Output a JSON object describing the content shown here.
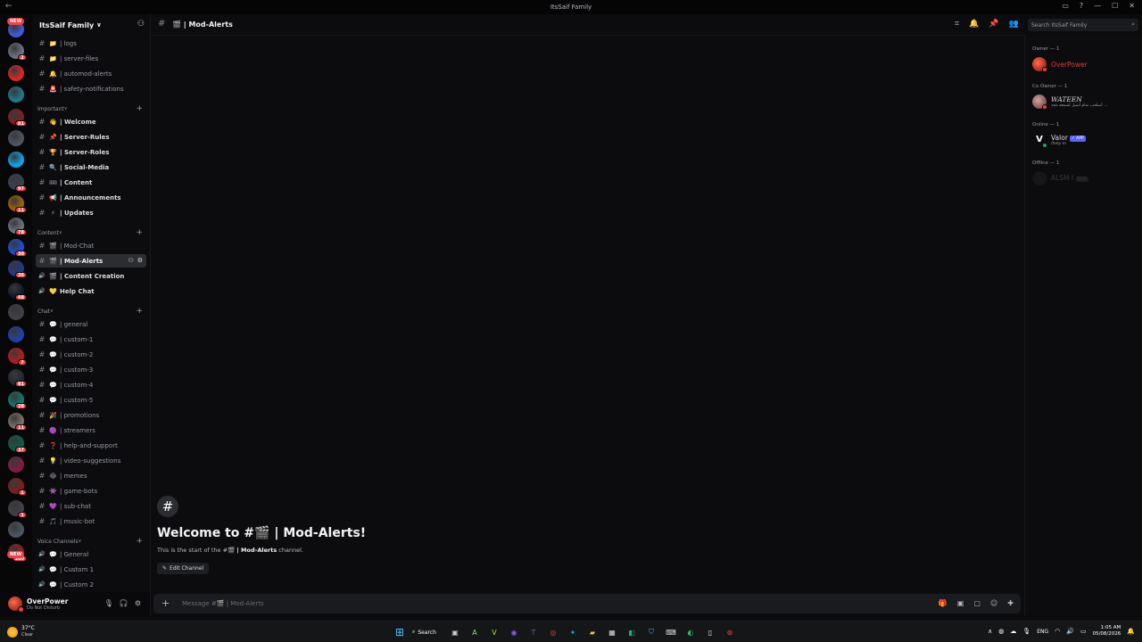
{
  "window": {
    "title": "ItsSaif Family"
  },
  "server": {
    "name": "ItsSaif Family"
  },
  "rail": [
    {
      "color": "#3b5bdb",
      "badge": "",
      "tag": "NEW"
    },
    {
      "color": "#6b7280",
      "badge": "2"
    },
    {
      "color": "#dc2626",
      "badge": ""
    },
    {
      "color": "#1e7a8c",
      "badge": ""
    },
    {
      "color": "#7f1d1d",
      "badge": "81"
    },
    {
      "color": "#4b5563",
      "badge": ""
    },
    {
      "color": "#0ea5e9",
      "badge": ""
    },
    {
      "color": "#374151",
      "badge": "97"
    },
    {
      "color": "#a16207",
      "badge": "11"
    },
    {
      "color": "#6b7280",
      "badge": "78"
    },
    {
      "color": "#1d4ed8",
      "badge": "30"
    },
    {
      "color": "#1e3a8a",
      "badge": "36"
    },
    {
      "color": "#111827",
      "badge": "48"
    },
    {
      "color": "#3f3f46",
      "badge": ""
    },
    {
      "color": "#1e40af",
      "badge": ""
    },
    {
      "color": "#b91c1c",
      "badge": "7"
    },
    {
      "color": "#1f2937",
      "badge": "81"
    },
    {
      "color": "#0f766e",
      "badge": "28"
    },
    {
      "color": "#78716c",
      "badge": "11"
    },
    {
      "color": "#065f46",
      "badge": "37"
    },
    {
      "color": "#831843",
      "badge": ""
    },
    {
      "color": "#7f1d1d",
      "badge": "1"
    },
    {
      "color": "#3f3f46",
      "badge": "1"
    },
    {
      "color": "#4b5563",
      "badge": ""
    },
    {
      "color": "#991b1b",
      "badge": "100",
      "tag": "NEW"
    }
  ],
  "channels_top": [
    {
      "emoji": "📁",
      "name": "| logs",
      "type": "text"
    },
    {
      "emoji": "📁",
      "name": "| server-files",
      "type": "text"
    },
    {
      "emoji": "🔔",
      "name": "| automod-alerts",
      "type": "text"
    },
    {
      "emoji": "🚨",
      "name": "| safety-notifications",
      "type": "text"
    }
  ],
  "categories": {
    "important": "Important",
    "content": "Content",
    "chat": "Chat",
    "voice": "Voice Channels"
  },
  "channels_important": [
    {
      "emoji": "👋",
      "name": "| Welcome",
      "type": "text"
    },
    {
      "emoji": "📌",
      "name": "| Server-Rules",
      "type": "text"
    },
    {
      "emoji": "🏆",
      "name": "| Server-Roles",
      "type": "text"
    },
    {
      "emoji": "🔍",
      "name": "| Social-Media",
      "type": "text"
    },
    {
      "emoji": "🎟",
      "name": "| Content",
      "type": "text"
    },
    {
      "emoji": "📢",
      "name": "| Announcements",
      "type": "text"
    },
    {
      "emoji": "⚡",
      "name": "| Updates",
      "type": "text"
    }
  ],
  "channels_content": [
    {
      "emoji": "🎬",
      "name": "| Mod-Chat",
      "type": "text"
    },
    {
      "emoji": "🎬",
      "name": "| Mod-Alerts",
      "type": "text",
      "selected": true
    },
    {
      "emoji": "🎬",
      "name": "| Content Creation",
      "type": "voice"
    },
    {
      "emoji": "💛",
      "name": "Help Chat",
      "type": "voice"
    }
  ],
  "channels_chat": [
    {
      "emoji": "💬",
      "name": "| general",
      "type": "text"
    },
    {
      "emoji": "💬",
      "name": "| custom-1",
      "type": "text"
    },
    {
      "emoji": "💬",
      "name": "| custom-2",
      "type": "text"
    },
    {
      "emoji": "💬",
      "name": "| custom-3",
      "type": "text"
    },
    {
      "emoji": "💬",
      "name": "| custom-4",
      "type": "text"
    },
    {
      "emoji": "💬",
      "name": "| custom-5",
      "type": "text"
    },
    {
      "emoji": "🎉",
      "name": "| promotions",
      "type": "text"
    },
    {
      "emoji": "🟣",
      "name": "| streamers",
      "type": "text"
    },
    {
      "emoji": "❓",
      "name": "| help-and-support",
      "type": "text"
    },
    {
      "emoji": "💡",
      "name": "| video-suggestions",
      "type": "text"
    },
    {
      "emoji": "😂",
      "name": "| memes",
      "type": "text"
    },
    {
      "emoji": "👾",
      "name": "| game-bots",
      "type": "text"
    },
    {
      "emoji": "💜",
      "name": "| sub-chat",
      "type": "text"
    },
    {
      "emoji": "🎵",
      "name": "| music-bot",
      "type": "text"
    }
  ],
  "channels_voice": [
    {
      "emoji": "💬",
      "name": "| General",
      "type": "voice"
    },
    {
      "emoji": "💬",
      "name": "| Custom 1",
      "type": "voice"
    },
    {
      "emoji": "💬",
      "name": "| Custom 2",
      "type": "voice"
    }
  ],
  "current_channel": {
    "name": "| Mod-Alerts",
    "emoji": "🎬"
  },
  "welcome": {
    "title_prefix": "Welcome to #",
    "title_suffix": " | Mod-Alerts!",
    "sub_prefix": "This is the start of the #",
    "sub_channel": " | Mod-Alerts",
    "sub_suffix": " channel.",
    "edit_label": "Edit Channel"
  },
  "composer": {
    "placeholder": "Message #🎬 | Mod-Alerts"
  },
  "search": {
    "placeholder": "Search ItsSaif Family"
  },
  "members": {
    "groups": [
      {
        "label": "Owner — 1"
      },
      {
        "label": "Co Owner — 1"
      },
      {
        "label": "Online — 1"
      },
      {
        "label": "Offline — 1"
      }
    ],
    "owner": {
      "name": "OverPower",
      "color": "#e03c3c"
    },
    "coowner": {
      "name": "WATEEN",
      "sub": "أصلحب تمام أشيل لشمعة مجد ...",
      "color": "#dbdee1"
    },
    "online": {
      "name": "Valor",
      "tag": "APP",
      "sub": "/help m"
    },
    "offline": {
      "name": "ALSM I",
      "tag": "SOS"
    }
  },
  "user": {
    "name": "OverPower",
    "status": "Do Not Disturb"
  },
  "taskbar": {
    "weather_temp": "37°C",
    "weather_desc": "Clear",
    "search_label": "Search",
    "lang": "ENG",
    "time": "1:05 AM",
    "date": "05/08/2026"
  },
  "colors": {
    "accent": "#5865f2",
    "dnd": "#f23f43",
    "online": "#23a55a",
    "bg": "#0c0c0e"
  }
}
